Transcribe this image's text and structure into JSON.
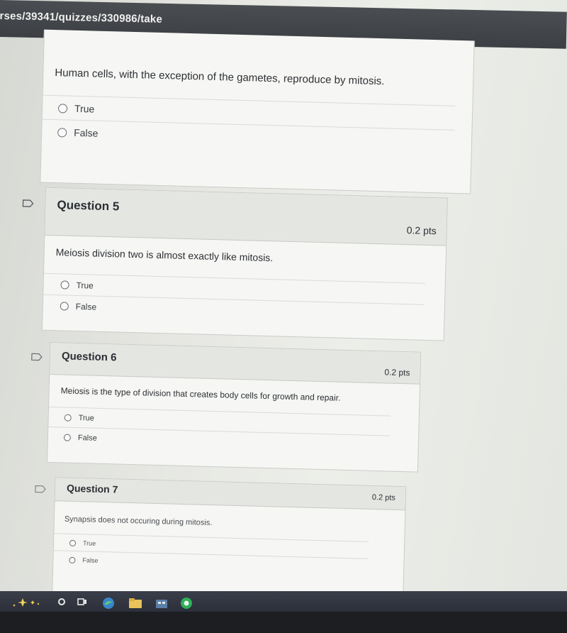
{
  "browser": {
    "url": "rses/39341/quizzes/330986/take"
  },
  "quiz": {
    "question4": {
      "text": "Human cells, with the exception of the gametes, reproduce by mitosis.",
      "answers": [
        "True",
        "False"
      ]
    },
    "question5": {
      "title": "Question 5",
      "points": "0.2 pts",
      "text": "Meiosis division two is almost exactly like mitosis.",
      "answers": [
        "True",
        "False"
      ]
    },
    "question6": {
      "title": "Question 6",
      "points": "0.2 pts",
      "text": "Meiosis is the type of division that creates body cells for growth and repair.",
      "answers": [
        "True",
        "False"
      ]
    },
    "question7": {
      "title": "Question 7",
      "points": "0.2 pts",
      "text": "Synapsis does not occuring during mitosis.",
      "answers": [
        "True",
        "False"
      ]
    }
  },
  "taskbar": {
    "icons": [
      "copilot-icon",
      "search-icon",
      "task-view-icon",
      "edge-icon",
      "file-explorer-icon",
      "store-icon",
      "chrome-icon"
    ]
  }
}
